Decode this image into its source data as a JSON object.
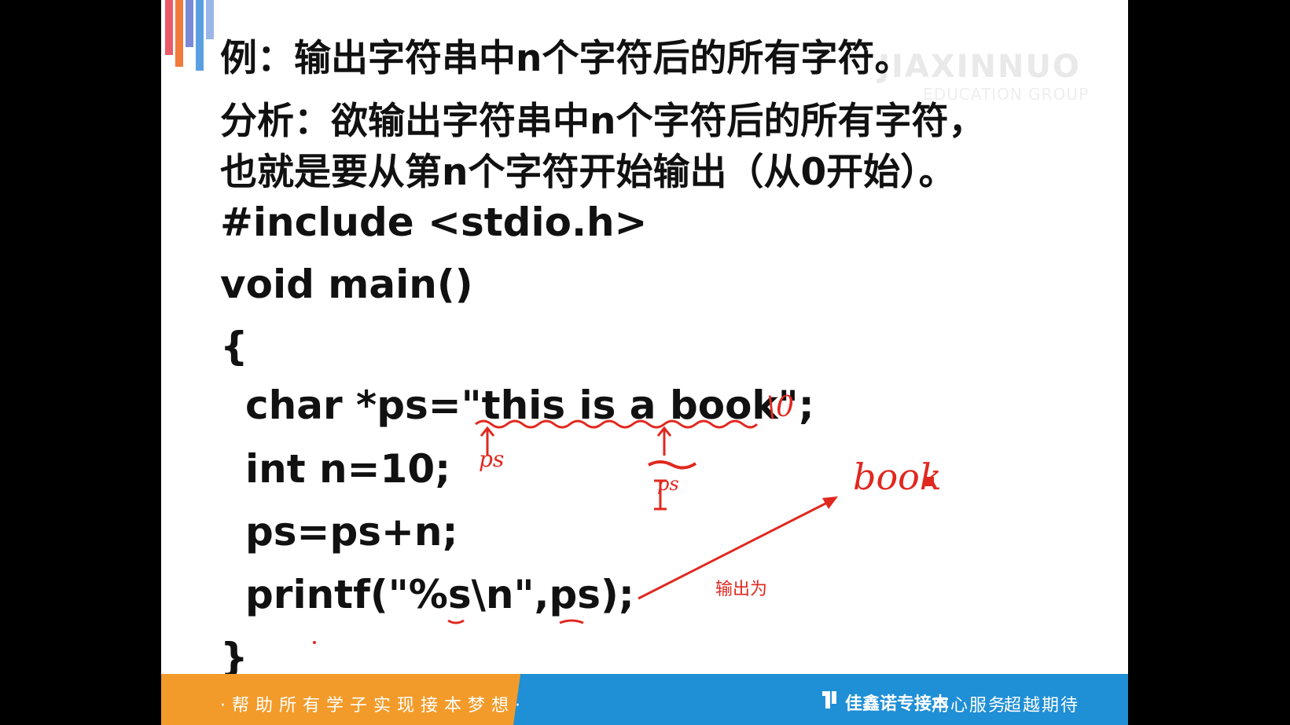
{
  "slide": {
    "example_line": "例：输出字符串中n个字符后的所有字符。",
    "analysis_line_1": "分析：欲输出字符串中n个字符后的所有字符，",
    "analysis_line_2": "也就是要从第n个字符开始输出（从0开始）。",
    "code": [
      "#include <stdio.h>",
      "void main()",
      "{",
      "char *ps=\"this is a book\";",
      "int n=10;",
      "ps=ps+n;",
      "printf(\"%s\\n\",ps);",
      "}"
    ],
    "watermark": "JIAXINNUO",
    "watermark_sub": "EDUCATION GROUP"
  },
  "annotations": {
    "output_label": "输出为",
    "output_value": "book",
    "pointer_label_1": "ps",
    "pointer_label_2": "ps",
    "terminator": "\\0"
  },
  "footer": {
    "slogan": "·帮助所有学子实现接本梦想·",
    "brand": "佳鑫诺专接本",
    "motto_1": "用心服务",
    "motto_2": "超越期待"
  },
  "colors": {
    "annotation_red": "#e0281f",
    "footer_orange": "#f39b2a",
    "footer_blue": "#1f8fd6"
  }
}
